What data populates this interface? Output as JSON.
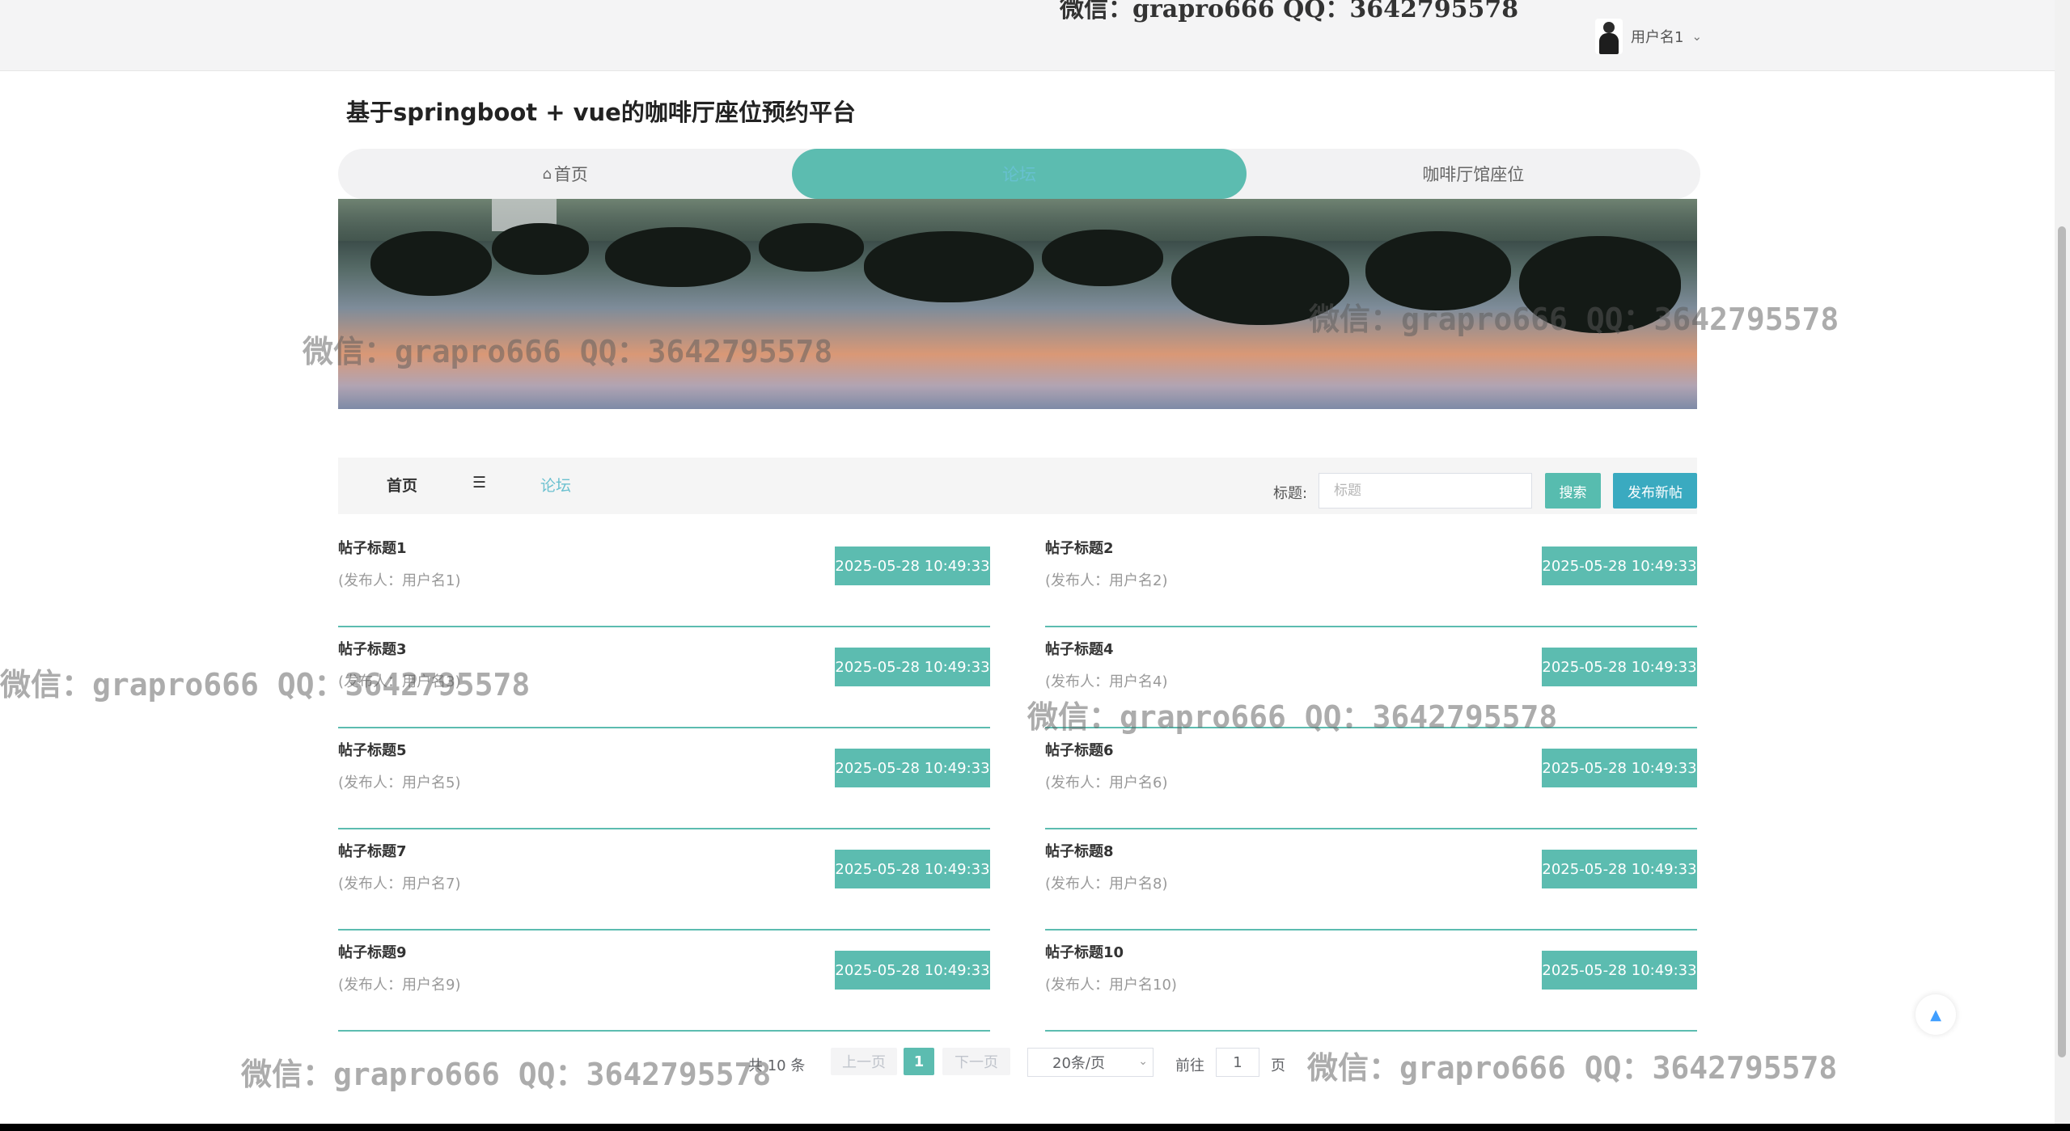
{
  "header": {
    "cut_title": "微信：grapro666 QQ：3642795578",
    "username": "用户名1",
    "chevron": "⌄"
  },
  "site_title": "基于springboot + vue的咖啡厅座位预约平台",
  "nav": [
    {
      "label": "首页",
      "icon": "home-icon"
    },
    {
      "label": "论坛"
    },
    {
      "label": "咖啡厅馆座位"
    }
  ],
  "breadcrumb": {
    "home": "首页",
    "separator": "☰",
    "current": "论坛"
  },
  "search": {
    "label": "标题:",
    "placeholder": "标题",
    "value": "",
    "search_button": "搜索",
    "new_button": "发布新帖"
  },
  "posts": [
    {
      "title": "帖子标题1",
      "author": "(发布人：用户名1)",
      "date": "2025-05-28 10:49:33"
    },
    {
      "title": "帖子标题2",
      "author": "(发布人：用户名2)",
      "date": "2025-05-28 10:49:33"
    },
    {
      "title": "帖子标题3",
      "author": "(发布人：用户名3)",
      "date": "2025-05-28 10:49:33"
    },
    {
      "title": "帖子标题4",
      "author": "(发布人：用户名4)",
      "date": "2025-05-28 10:49:33"
    },
    {
      "title": "帖子标题5",
      "author": "(发布人：用户名5)",
      "date": "2025-05-28 10:49:33"
    },
    {
      "title": "帖子标题6",
      "author": "(发布人：用户名6)",
      "date": "2025-05-28 10:49:33"
    },
    {
      "title": "帖子标题7",
      "author": "(发布人：用户名7)",
      "date": "2025-05-28 10:49:33"
    },
    {
      "title": "帖子标题8",
      "author": "(发布人：用户名8)",
      "date": "2025-05-28 10:49:33"
    },
    {
      "title": "帖子标题9",
      "author": "(发布人：用户名9)",
      "date": "2025-05-28 10:49:33"
    },
    {
      "title": "帖子标题10",
      "author": "(发布人：用户名10)",
      "date": "2025-05-28 10:49:33"
    }
  ],
  "pagination": {
    "total": "共 10 条",
    "prev": "上一页",
    "current_page": "1",
    "next": "下一页",
    "page_size": "20条/页",
    "goto_label": "前往",
    "goto_value": "1",
    "page_unit": "页"
  },
  "backtop_glyph": "▲",
  "watermark": "微信：grapro666 QQ：3642795578"
}
